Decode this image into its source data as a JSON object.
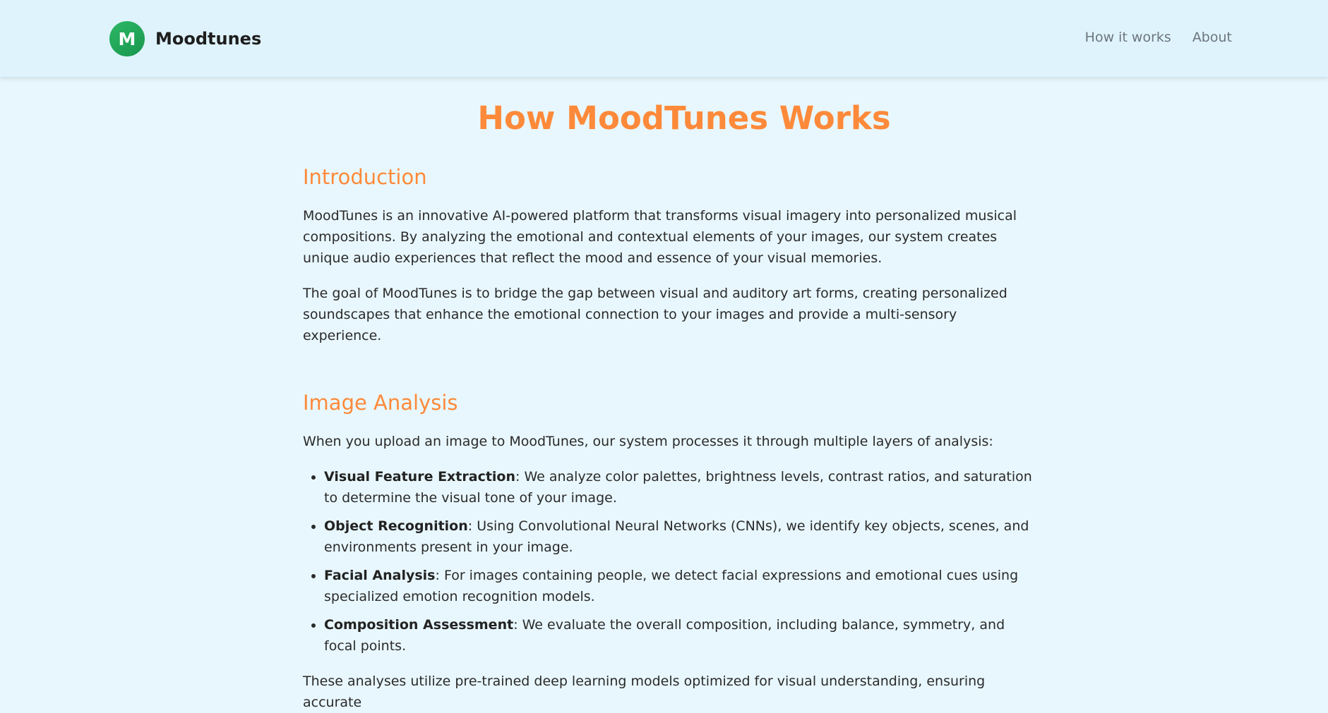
{
  "brand": {
    "logo_letter": "M",
    "name": "Moodtunes"
  },
  "nav": {
    "items": [
      {
        "label": "How it works"
      },
      {
        "label": "About"
      }
    ]
  },
  "page": {
    "title": "How MoodTunes Works",
    "sections": [
      {
        "heading": "Introduction",
        "paragraphs": [
          "MoodTunes is an innovative AI-powered platform that transforms visual imagery into personalized musical compositions. By analyzing the emotional and contextual elements of your images, our system creates unique audio experiences that reflect the mood and essence of your visual memories.",
          "The goal of MoodTunes is to bridge the gap between visual and auditory art forms, creating personalized soundscapes that enhance the emotional connection to your images and provide a multi-sensory experience."
        ]
      },
      {
        "heading": "Image Analysis",
        "intro": "When you upload an image to MoodTunes, our system processes it through multiple layers of analysis:",
        "items": [
          {
            "term": "Visual Feature Extraction",
            "text": ": We analyze color palettes, brightness levels, contrast ratios, and saturation to determine the visual tone of your image."
          },
          {
            "term": "Object Recognition",
            "text": ": Using Convolutional Neural Networks (CNNs), we identify key objects, scenes, and environments present in your image."
          },
          {
            "term": "Facial Analysis",
            "text": ": For images containing people, we detect facial expressions and emotional cues using specialized emotion recognition models."
          },
          {
            "term": "Composition Assessment",
            "text": ": We evaluate the overall composition, including balance, symmetry, and focal points."
          }
        ],
        "outro": "These analyses utilize pre-trained deep learning models optimized for visual understanding, ensuring accurate"
      }
    ]
  },
  "colors": {
    "accent": "#fd8a3a",
    "logo": "#1fa85a",
    "background": "#e8f7fd",
    "navbar": "#dff3fc"
  }
}
